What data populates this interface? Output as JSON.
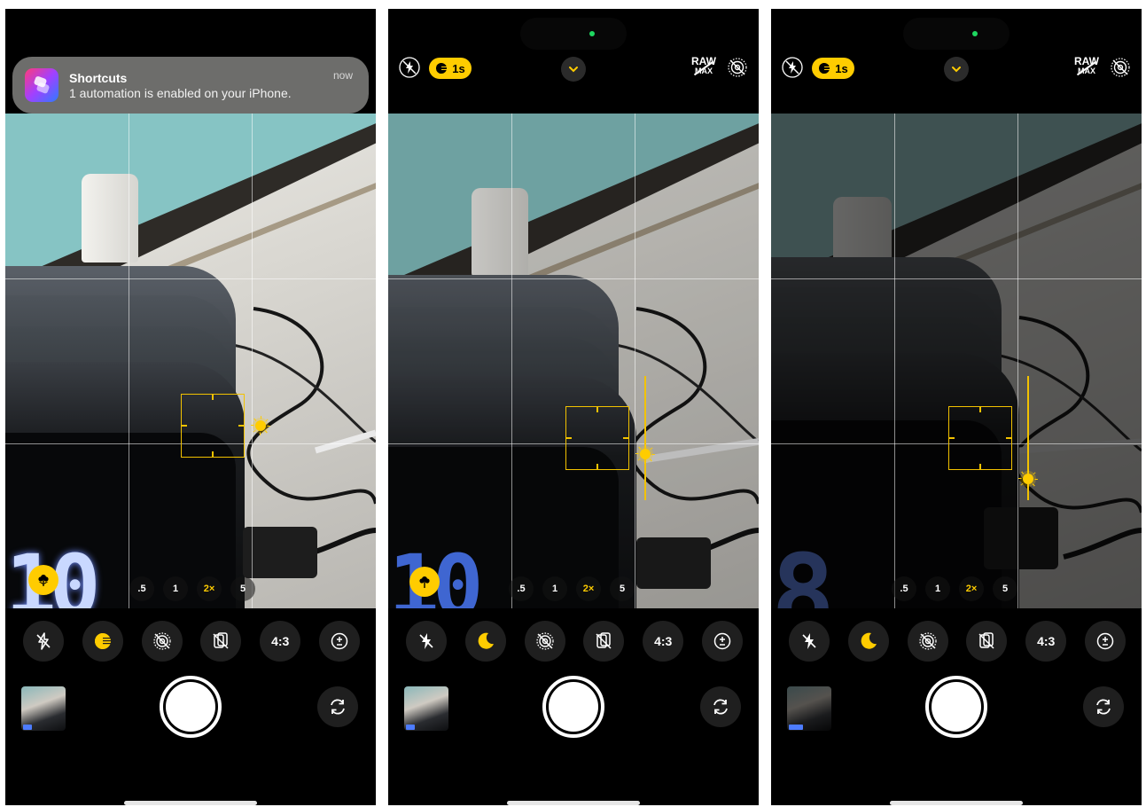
{
  "panels": [
    {
      "id": "phone-1",
      "notification": {
        "app": "Shortcuts",
        "message": "1 automation is enabled on your iPhone.",
        "time": "now"
      },
      "zoom_levels": [
        ".5",
        "1",
        "2×",
        "5"
      ],
      "active_zoom": "2×",
      "aspect_ratio": "4:3"
    },
    {
      "id": "phone-2",
      "night_mode_duration": "1s",
      "raw_label": "RAW",
      "raw_sub": "MAX",
      "zoom_levels": [
        ".5",
        "1",
        "2×",
        "5"
      ],
      "active_zoom": "2×",
      "aspect_ratio": "4:3"
    },
    {
      "id": "phone-3",
      "night_mode_duration": "1s",
      "raw_label": "RAW",
      "raw_sub": "MAX",
      "zoom_levels": [
        ".5",
        "1",
        "2×",
        "5"
      ],
      "active_zoom": "2×",
      "aspect_ratio": "4:3"
    }
  ],
  "colors": {
    "accent_yellow": "#ffcc00",
    "control_bg": "#1f1f1f",
    "background": "#000000"
  },
  "icons": [
    "flash-off-icon",
    "night-mode-icon",
    "live-photo-off-icon",
    "styles-icon",
    "exposure-icon",
    "camera-flip-icon",
    "chevron-down-icon",
    "macro-flower-icon",
    "shortcuts-app-icon"
  ]
}
